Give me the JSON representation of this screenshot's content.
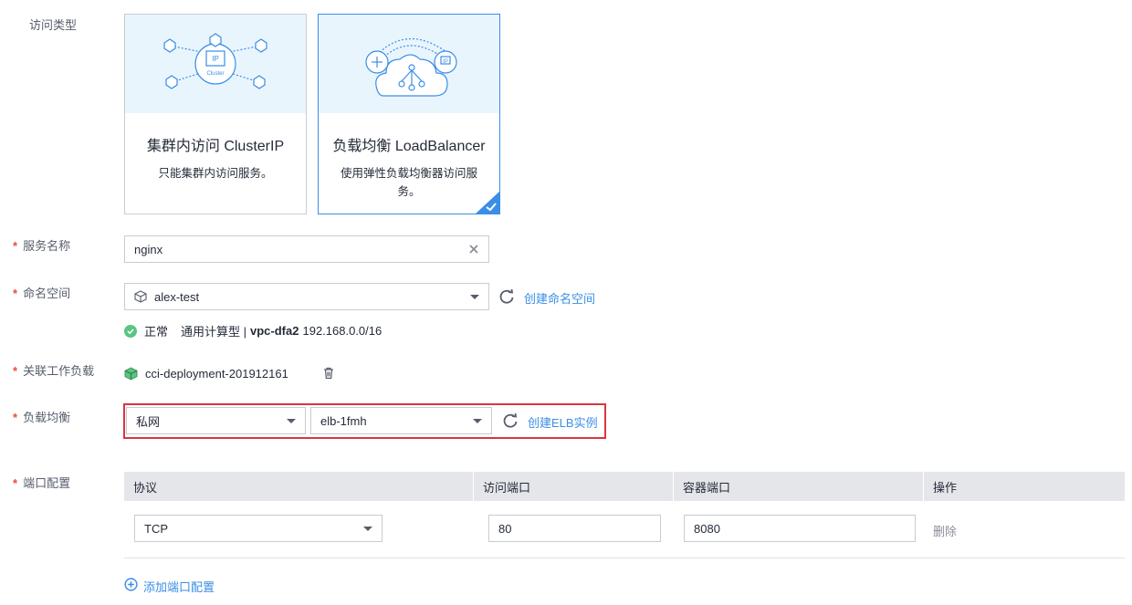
{
  "labels": {
    "access_type": "访问类型",
    "service_name": "服务名称",
    "namespace": "命名空间",
    "workload": "关联工作负载",
    "load_balancer": "负载均衡",
    "port_config": "端口配置"
  },
  "required_mark": "*",
  "cards": [
    {
      "title": "集群内访问 ClusterIP",
      "desc": "只能集群内访问服务。",
      "icon_text_ip": "IP",
      "icon_text_cluster": "Cluster",
      "selected": false
    },
    {
      "title": "负载均衡 LoadBalancer",
      "desc": "使用弹性负载均衡器访问服务。",
      "icon_text_ip": "IP",
      "selected": true
    }
  ],
  "service_name": {
    "value": "nginx",
    "clear_icon": "close-icon"
  },
  "namespace": {
    "value": "alex-test",
    "create_link": "创建命名空间",
    "status_text": "正常",
    "type_text": "通用计算型 |",
    "vpc": "vpc-dfa2",
    "cidr": "192.168.0.0/16"
  },
  "workload": {
    "value": "cci-deployment-201912161"
  },
  "load_balancer": {
    "network": "私网",
    "elb": "elb-1fmh",
    "create_link": "创建ELB实例"
  },
  "port_table": {
    "headers": [
      "协议",
      "访问端口",
      "容器端口",
      "操作"
    ],
    "rows": [
      {
        "protocol": "TCP",
        "access_port": "80",
        "container_port": "8080",
        "action": "删除"
      }
    ],
    "add_link": "添加端口配置"
  },
  "colors": {
    "accent": "#3a8ee6",
    "required": "#e74c3c",
    "highlight": "#d9363e",
    "ok": "#5ac580"
  }
}
